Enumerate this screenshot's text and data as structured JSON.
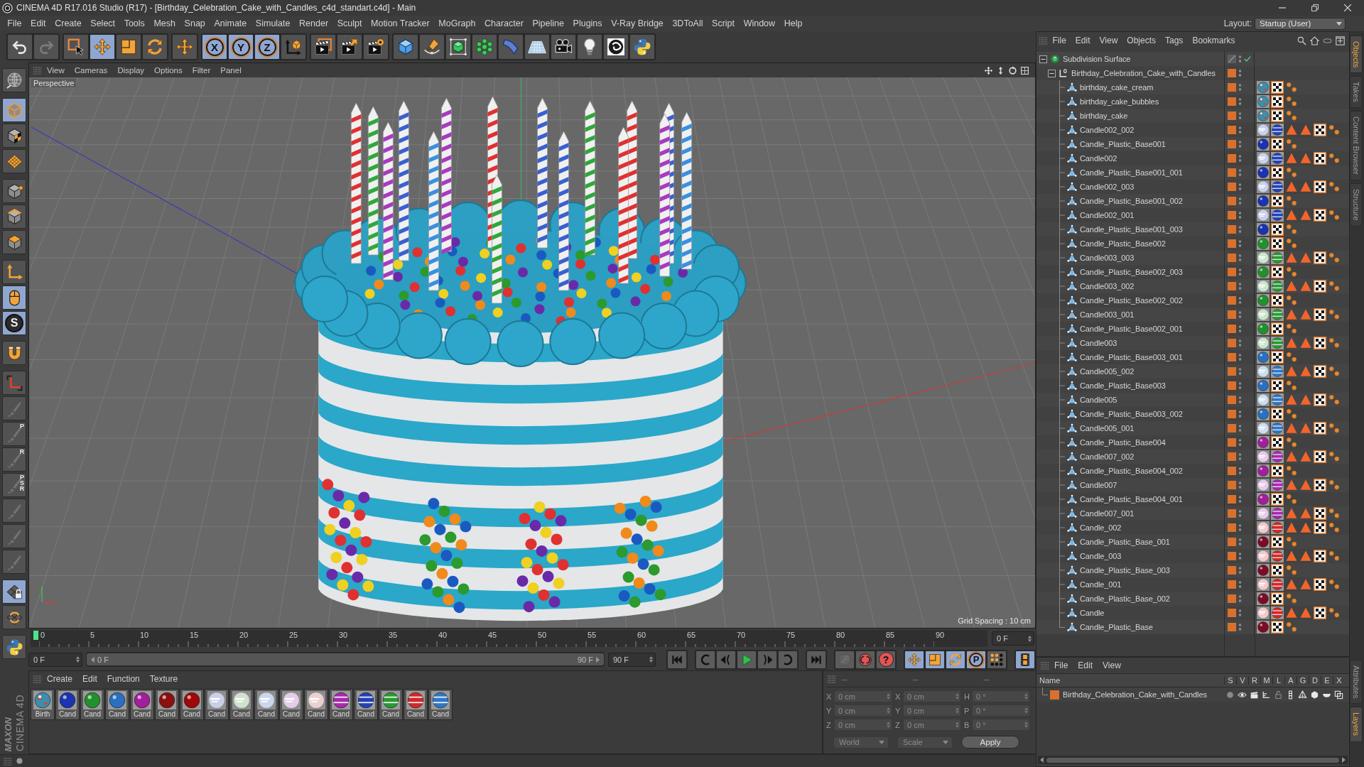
{
  "window": {
    "title": "CINEMA 4D R17.016 Studio (R17) - [Birthday_Celebration_Cake_with_Candles_c4d_standart.c4d] - Main"
  },
  "menu_bar": [
    "File",
    "Edit",
    "Create",
    "Select",
    "Tools",
    "Mesh",
    "Snap",
    "Animate",
    "Simulate",
    "Render",
    "Sculpt",
    "Motion Tracker",
    "MoGraph",
    "Character",
    "Pipeline",
    "Plugins",
    "V-Ray Bridge",
    "3DToAll",
    "Script",
    "Window",
    "Help"
  ],
  "layout": {
    "label": "Layout:",
    "value": "Startup (User)"
  },
  "toolbar": [
    [
      {
        "kind": "undo",
        "on": false,
        "disabled": false
      },
      {
        "kind": "redo",
        "on": false,
        "disabled": true
      }
    ],
    [
      {
        "kind": "select",
        "on": false,
        "disabled": false
      },
      {
        "kind": "move",
        "on": true,
        "disabled": false
      },
      {
        "kind": "scale",
        "on": false,
        "disabled": false
      },
      {
        "kind": "rotate",
        "on": false,
        "disabled": false
      }
    ],
    [
      {
        "kind": "transform",
        "on": false,
        "disabled": false
      }
    ],
    [
      {
        "kind": "axis",
        "label": "X",
        "on": true,
        "disabled": false
      },
      {
        "kind": "axis",
        "label": "Y",
        "on": true,
        "disabled": false
      },
      {
        "kind": "axis",
        "label": "Z",
        "on": true,
        "disabled": false
      },
      {
        "kind": "coords",
        "on": false,
        "disabled": false
      }
    ],
    [
      {
        "kind": "renderview",
        "on": false,
        "disabled": false
      },
      {
        "kind": "render",
        "on": false,
        "disabled": false
      },
      {
        "kind": "settings",
        "on": false,
        "disabled": false
      }
    ],
    [
      {
        "kind": "cube",
        "on": false,
        "disabled": false
      },
      {
        "kind": "pen",
        "on": false,
        "disabled": false
      },
      {
        "kind": "subdivision",
        "on": false,
        "disabled": false
      },
      {
        "kind": "cloner",
        "on": false,
        "disabled": false
      },
      {
        "kind": "deformer",
        "on": false,
        "disabled": false
      },
      {
        "kind": "floor",
        "on": false,
        "disabled": false
      },
      {
        "kind": "camera",
        "on": false,
        "disabled": false
      },
      {
        "kind": "light",
        "on": false,
        "disabled": false
      },
      {
        "kind": "plugin",
        "on": false,
        "disabled": false
      },
      {
        "kind": "python",
        "on": false,
        "disabled": false
      }
    ]
  ],
  "left_tools": [
    [
      {
        "kind": "globe",
        "on": false,
        "disabled": false
      }
    ],
    [
      {
        "kind": "model",
        "on": true,
        "disabled": false
      },
      {
        "kind": "texture",
        "on": false,
        "disabled": false
      },
      {
        "kind": "workplane",
        "on": false,
        "disabled": false
      }
    ],
    [
      {
        "kind": "points",
        "on": false,
        "disabled": false
      },
      {
        "kind": "edges",
        "on": false,
        "disabled": false
      },
      {
        "kind": "polygons",
        "on": false,
        "disabled": false
      }
    ],
    [
      {
        "kind": "axes",
        "on": false,
        "disabled": false
      },
      {
        "kind": "tweak",
        "on": true,
        "disabled": false
      },
      {
        "kind": "snap",
        "label": "S",
        "on": true,
        "disabled": false
      }
    ],
    [
      {
        "kind": "magnet",
        "on": false,
        "disabled": false
      }
    ],
    [
      {
        "kind": "corner",
        "on": false,
        "disabled": false
      },
      {
        "kind": "brush",
        "on": false,
        "disabled": true
      },
      {
        "kind": "brush",
        "label": "P",
        "on": false,
        "disabled": true
      },
      {
        "kind": "brush",
        "label": "R",
        "on": false,
        "disabled": true
      },
      {
        "kind": "brush",
        "label": "PSR",
        "on": false,
        "disabled": true
      },
      {
        "kind": "brush",
        "on": false,
        "disabled": true
      },
      {
        "kind": "brush",
        "on": false,
        "disabled": true
      },
      {
        "kind": "brush",
        "on": false,
        "disabled": true
      }
    ],
    [
      {
        "kind": "gridlock",
        "on": true,
        "disabled": false
      },
      {
        "kind": "gridrotate",
        "on": false,
        "disabled": false
      }
    ],
    [
      {
        "kind": "python",
        "on": false,
        "disabled": false
      }
    ]
  ],
  "viewport": {
    "menu": [
      "View",
      "Cameras",
      "Display",
      "Options",
      "Filter",
      "Panel"
    ],
    "camera": "Perspective",
    "grid_spacing": "Grid Spacing : 10 cm"
  },
  "timeline": {
    "ticks": [
      "0",
      "5",
      "10",
      "15",
      "20",
      "25",
      "30",
      "35",
      "40",
      "45",
      "50",
      "55",
      "60",
      "65",
      "70",
      "75",
      "80",
      "85",
      "90"
    ],
    "level": 0,
    "current": "0 F"
  },
  "transport": {
    "start": "0 F",
    "range": {
      "start": "0 F",
      "end": "90 F",
      "level": 1
    },
    "end": "90 F",
    "buttons": [
      [
        {
          "kind": "gostart",
          "on": false,
          "disabled": false
        }
      ],
      [
        {
          "kind": "prevkey",
          "on": false,
          "disabled": false
        },
        {
          "kind": "stepback",
          "on": false,
          "disabled": false
        },
        {
          "kind": "play",
          "on": false,
          "disabled": false
        },
        {
          "kind": "stepfwd",
          "on": false,
          "disabled": false
        },
        {
          "kind": "nextkey",
          "on": false,
          "disabled": false
        }
      ],
      [
        {
          "kind": "goend",
          "on": false,
          "disabled": false
        }
      ],
      [
        {
          "kind": "keylock",
          "on": false,
          "disabled": true
        },
        {
          "kind": "record",
          "on": false,
          "disabled": false
        },
        {
          "kind": "autokey",
          "label": "?",
          "on": false,
          "disabled": false
        }
      ],
      [
        {
          "kind": "move",
          "on": true,
          "disabled": false
        },
        {
          "kind": "scale",
          "on": true,
          "disabled": false
        },
        {
          "kind": "rotate",
          "on": true,
          "disabled": false
        },
        {
          "kind": "param",
          "label": "P",
          "on": true,
          "disabled": false
        },
        {
          "kind": "dots",
          "on": false,
          "disabled": false
        }
      ],
      [
        {
          "kind": "filmstrip",
          "on": true,
          "disabled": false
        }
      ]
    ]
  },
  "material_manager": {
    "menu": [
      "Create",
      "Edit",
      "Function",
      "Texture"
    ],
    "materials": [
      {
        "label": "Birth",
        "kind": "texture",
        "selected": false
      },
      {
        "label": "Cand",
        "kind": "glossy",
        "color": "#1b33b0",
        "selected": false
      },
      {
        "label": "Cand",
        "kind": "glossy",
        "color": "#22902c",
        "selected": false
      },
      {
        "label": "Cand",
        "kind": "glossy",
        "color": "#2a6fc0",
        "selected": false
      },
      {
        "label": "Cand",
        "kind": "glossy",
        "color": "#a21f9c",
        "selected": false
      },
      {
        "label": "Cand",
        "kind": "glossy",
        "color": "#8c1010",
        "selected": false
      },
      {
        "label": "Cand",
        "kind": "glossy",
        "color": "#a00808",
        "selected": false
      },
      {
        "label": "Cand",
        "kind": "glass",
        "color": "#c9cfe8",
        "selected": false
      },
      {
        "label": "Cand",
        "kind": "glass",
        "color": "#cfe3cf",
        "selected": false
      },
      {
        "label": "Cand",
        "kind": "glass",
        "color": "#c9d6ec",
        "selected": false
      },
      {
        "label": "Cand",
        "kind": "glass",
        "color": "#e3cdea",
        "selected": false
      },
      {
        "label": "Cand",
        "kind": "glass",
        "color": "#ecd0d0",
        "selected": false
      },
      {
        "label": "Cand",
        "kind": "striped",
        "color": "#a82ab0",
        "selected": false
      },
      {
        "label": "Cand",
        "kind": "striped",
        "color": "#2342b8",
        "selected": false
      },
      {
        "label": "Cand",
        "kind": "striped",
        "color": "#2a9a34",
        "selected": false
      },
      {
        "label": "Cand",
        "kind": "striped",
        "color": "#d42828",
        "selected": false
      },
      {
        "label": "Cand",
        "kind": "striped",
        "color": "#2f78c8",
        "selected": false
      }
    ]
  },
  "coordinates": {
    "headers": [
      "--",
      "--",
      "--"
    ],
    "disabled": true,
    "columns": [
      [
        {
          "label": "X",
          "value": "0 cm"
        },
        {
          "label": "Y",
          "value": "0 cm"
        },
        {
          "label": "Z",
          "value": "0 cm"
        }
      ],
      [
        {
          "label": "X",
          "value": "0 cm"
        },
        {
          "label": "Y",
          "value": "0 cm"
        },
        {
          "label": "Z",
          "value": "0 cm"
        }
      ],
      [
        {
          "label": "H",
          "value": "0 °"
        },
        {
          "label": "P",
          "value": "0 °"
        },
        {
          "label": "B",
          "value": "0 °"
        }
      ]
    ],
    "dropdowns": [
      "World",
      "Scale"
    ],
    "apply": "Apply"
  },
  "object_manager": {
    "menu": [
      "File",
      "Edit",
      "View",
      "Objects",
      "Tags",
      "Bookmarks"
    ],
    "tree": [
      {
        "name": "Subdivision Surface",
        "kind": "subdivision",
        "expanded": true,
        "enabled": true,
        "layer": false,
        "selected": false,
        "children": [
          {
            "name": "Birthday_Celebration_Cake_with_Candles",
            "kind": "null",
            "expanded": true,
            "layer": true,
            "selected": false,
            "children": [
              {
                "name": "birthday_cake_cream",
                "kind": "cake",
                "layer": true,
                "selected": false
              },
              {
                "name": "birthday_cake_bubbles",
                "kind": "cake",
                "layer": true,
                "selected": false
              },
              {
                "name": "birthday_cake",
                "kind": "cake",
                "layer": true,
                "selected": false
              },
              {
                "name": "Candle002_002",
                "kind": "candle",
                "color": "#2342b8",
                "layer": true,
                "selected": false
              },
              {
                "name": "Candle_Plastic_Base001",
                "kind": "base",
                "color": "#1b33b0",
                "layer": true,
                "selected": false
              },
              {
                "name": "Candle002",
                "kind": "candle",
                "color": "#2342b8",
                "layer": true,
                "selected": false
              },
              {
                "name": "Candle_Plastic_Base001_001",
                "kind": "base",
                "color": "#1b33b0",
                "layer": true,
                "selected": false
              },
              {
                "name": "Candle002_003",
                "kind": "candle",
                "color": "#2342b8",
                "layer": true,
                "selected": false
              },
              {
                "name": "Candle_Plastic_Base001_002",
                "kind": "base",
                "color": "#1b33b0",
                "layer": true,
                "selected": false
              },
              {
                "name": "Candle002_001",
                "kind": "candle",
                "color": "#2342b8",
                "layer": true,
                "selected": false
              },
              {
                "name": "Candle_Plastic_Base001_003",
                "kind": "base",
                "color": "#1b33b0",
                "layer": true,
                "selected": false
              },
              {
                "name": "Candle_Plastic_Base002",
                "kind": "base",
                "color": "#22902c",
                "layer": true,
                "selected": false
              },
              {
                "name": "Candle003_003",
                "kind": "candle",
                "color": "#2a9a34",
                "layer": true,
                "selected": false
              },
              {
                "name": "Candle_Plastic_Base002_003",
                "kind": "base",
                "color": "#22902c",
                "layer": true,
                "selected": false
              },
              {
                "name": "Candle003_002",
                "kind": "candle",
                "color": "#2a9a34",
                "layer": true,
                "selected": false
              },
              {
                "name": "Candle_Plastic_Base002_002",
                "kind": "base",
                "color": "#22902c",
                "layer": true,
                "selected": false
              },
              {
                "name": "Candle003_001",
                "kind": "candle",
                "color": "#2a9a34",
                "layer": true,
                "selected": false
              },
              {
                "name": "Candle_Plastic_Base002_001",
                "kind": "base",
                "color": "#22902c",
                "layer": true,
                "selected": false
              },
              {
                "name": "Candle003",
                "kind": "candle",
                "color": "#2a9a34",
                "layer": true,
                "selected": false
              },
              {
                "name": "Candle_Plastic_Base003_001",
                "kind": "base",
                "color": "#2a6fc0",
                "layer": true,
                "selected": false
              },
              {
                "name": "Candle005_002",
                "kind": "candle",
                "color": "#2f78c8",
                "layer": true,
                "selected": false
              },
              {
                "name": "Candle_Plastic_Base003",
                "kind": "base",
                "color": "#2a6fc0",
                "layer": true,
                "selected": false
              },
              {
                "name": "Candle005",
                "kind": "candle",
                "color": "#2f78c8",
                "layer": true,
                "selected": false
              },
              {
                "name": "Candle_Plastic_Base003_002",
                "kind": "base",
                "color": "#2a6fc0",
                "layer": true,
                "selected": false
              },
              {
                "name": "Candle005_001",
                "kind": "candle",
                "color": "#2f78c8",
                "layer": true,
                "selected": false
              },
              {
                "name": "Candle_Plastic_Base004",
                "kind": "base",
                "color": "#a21f9c",
                "layer": true,
                "selected": false
              },
              {
                "name": "Candle007_002",
                "kind": "candle",
                "color": "#a82ab0",
                "layer": true,
                "selected": false
              },
              {
                "name": "Candle_Plastic_Base004_002",
                "kind": "base",
                "color": "#a21f9c",
                "layer": true,
                "selected": false
              },
              {
                "name": "Candle007",
                "kind": "candle",
                "color": "#a82ab0",
                "layer": true,
                "selected": false
              },
              {
                "name": "Candle_Plastic_Base004_001",
                "kind": "base",
                "color": "#a21f9c",
                "layer": true,
                "selected": false
              },
              {
                "name": "Candle007_001",
                "kind": "candle",
                "color": "#a82ab0",
                "layer": true,
                "selected": false
              },
              {
                "name": "Candle_002",
                "kind": "candle",
                "color": "#d42828",
                "layer": true,
                "selected": false
              },
              {
                "name": "Candle_Plastic_Base_001",
                "kind": "base",
                "color": "#7c0c26",
                "layer": true,
                "selected": false
              },
              {
                "name": "Candle_003",
                "kind": "candle",
                "color": "#d42828",
                "layer": true,
                "selected": false
              },
              {
                "name": "Candle_Plastic_Base_003",
                "kind": "base",
                "color": "#7c0c26",
                "layer": true,
                "selected": false
              },
              {
                "name": "Candle_001",
                "kind": "candle",
                "color": "#d42828",
                "layer": true,
                "selected": false
              },
              {
                "name": "Candle_Plastic_Base_002",
                "kind": "base",
                "color": "#7c0c26",
                "layer": true,
                "selected": false
              },
              {
                "name": "Candle",
                "kind": "candle",
                "color": "#d42828",
                "layer": true,
                "selected": false
              },
              {
                "name": "Candle_Plastic_Base",
                "kind": "base",
                "color": "#7c0c26",
                "layer": true,
                "selected": false
              }
            ]
          }
        ]
      }
    ]
  },
  "layer_manager": {
    "menu": [
      "File",
      "Edit",
      "View"
    ],
    "columns": [
      "Name",
      "S",
      "V",
      "R",
      "M",
      "L",
      "A",
      "G",
      "D",
      "E",
      "X"
    ],
    "rows": [
      {
        "name": "Birthday_Celebration_Cake_with_Candles",
        "color": "#d9712c",
        "selected": false,
        "flags": [
          {
            "kind": "solo",
            "on": false
          },
          {
            "kind": "view",
            "on": true
          },
          {
            "kind": "render",
            "on": true
          },
          {
            "kind": "manager",
            "on": true
          },
          {
            "kind": "lock",
            "on": false
          },
          {
            "kind": "animation",
            "on": true
          },
          {
            "kind": "generators",
            "on": true
          },
          {
            "kind": "deformers",
            "on": true
          },
          {
            "kind": "expressions",
            "on": true
          },
          {
            "kind": "xref",
            "on": true
          }
        ]
      }
    ]
  },
  "side_tabs": {
    "top": [
      {
        "label": "Objects",
        "selected": true
      },
      {
        "label": "Takes",
        "selected": false
      },
      {
        "label": "Content Browser",
        "selected": false
      },
      {
        "label": "Structure",
        "selected": false
      }
    ],
    "bottom": [
      {
        "label": "Attributes",
        "selected": false
      },
      {
        "label": "Layers",
        "selected": true
      }
    ]
  },
  "brand": {
    "company": "MAXON",
    "product": "CINEMA 4D"
  }
}
